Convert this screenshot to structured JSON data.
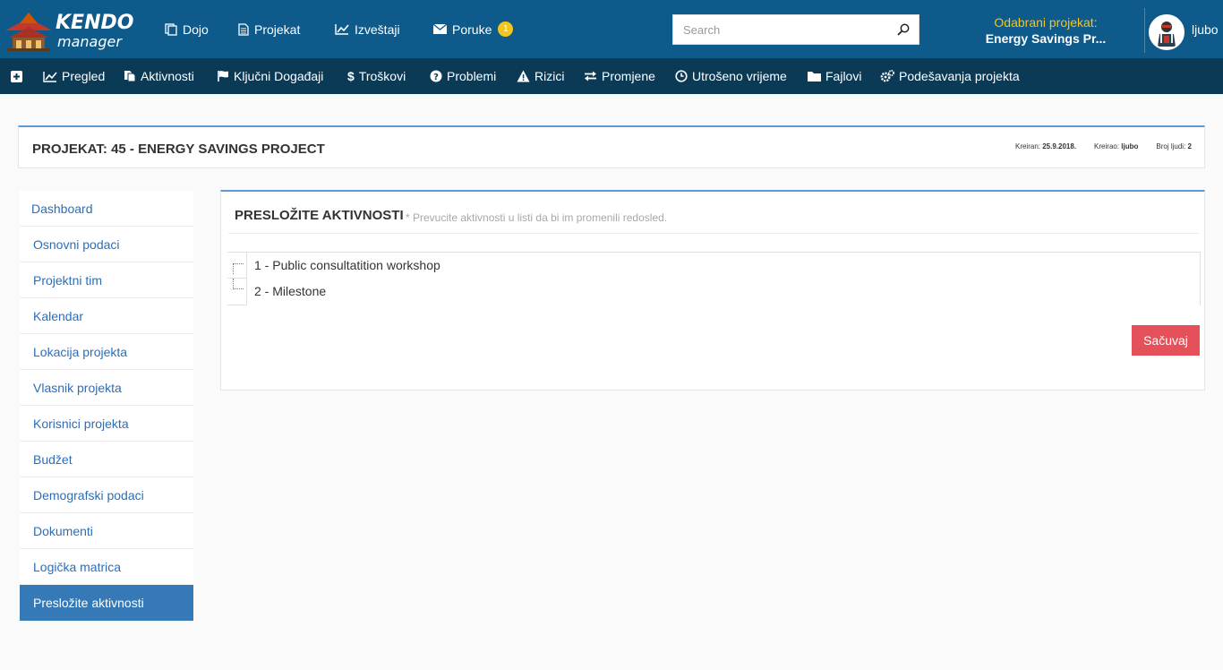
{
  "brand": {
    "name": "KENDO manager",
    "accent": "#0e5a8a"
  },
  "topnav": [
    {
      "label": "Dojo",
      "icon": "copy-icon"
    },
    {
      "label": "Projekat",
      "icon": "document-icon"
    },
    {
      "label": "Izveštaji",
      "icon": "line-chart-icon"
    },
    {
      "label": "Poruke",
      "icon": "envelope-icon",
      "badge": "1"
    }
  ],
  "search": {
    "placeholder": "Search"
  },
  "selected_project": {
    "label": "Odabrani projekat:",
    "value": "Energy Savings Pr..."
  },
  "user": {
    "name": "ljubo"
  },
  "subnav": [
    {
      "label": "",
      "icon": "plus-square-icon"
    },
    {
      "label": "Pregled",
      "icon": "line-chart-icon"
    },
    {
      "label": "Aktivnosti",
      "icon": "files-icon"
    },
    {
      "label": "Ključni Događaji",
      "icon": "flag-icon"
    },
    {
      "label": "Troškovi",
      "icon": "dollar-icon"
    },
    {
      "label": "Problemi",
      "icon": "question-circle-icon"
    },
    {
      "label": "Rizici",
      "icon": "warning-icon"
    },
    {
      "label": "Promjene",
      "icon": "exchange-icon"
    },
    {
      "label": "Utrošeno vrijeme",
      "icon": "clock-icon"
    },
    {
      "label": "Fajlovi",
      "icon": "folder-icon"
    },
    {
      "label": "Podešavanja projekta",
      "icon": "gears-icon"
    }
  ],
  "project": {
    "title": "PROJEKAT: 45 - ENERGY SAVINGS PROJECT",
    "created_label": "Kreiran:",
    "created_value": "25.9.2018.",
    "creator_label": "Kreirao:",
    "creator_value": "ljubo",
    "people_label": "Broj ljudi:",
    "people_value": "2"
  },
  "sidebar": {
    "items": [
      {
        "label": "Dashboard"
      },
      {
        "label": "Osnovni podaci"
      },
      {
        "label": "Projektni tim"
      },
      {
        "label": "Kalendar"
      },
      {
        "label": "Lokacija projekta"
      },
      {
        "label": "Vlasnik projekta"
      },
      {
        "label": "Korisnici projekta"
      },
      {
        "label": "Budžet"
      },
      {
        "label": "Demografski podaci"
      },
      {
        "label": "Dokumenti"
      },
      {
        "label": "Logička matrica"
      },
      {
        "label": "Presložite aktivnosti",
        "active": true
      }
    ]
  },
  "panel": {
    "title": "PRESLOŽITE AKTIVNOSTI",
    "hint": "* Prevucite aktivnosti u listi da bi im promenili redosled.",
    "activities": [
      {
        "label": "1 - Public consultatition workshop"
      },
      {
        "label": "2 - Milestone"
      }
    ],
    "save_label": "Sačuvaj"
  },
  "colors": {
    "top_bar": "#0e5a8a",
    "sub_bar": "#0a3a56",
    "link": "#2a6ebb",
    "active": "#357ab7",
    "save": "#e5515a",
    "badge": "#f5c518",
    "panel_border": "#5e9bd6"
  }
}
